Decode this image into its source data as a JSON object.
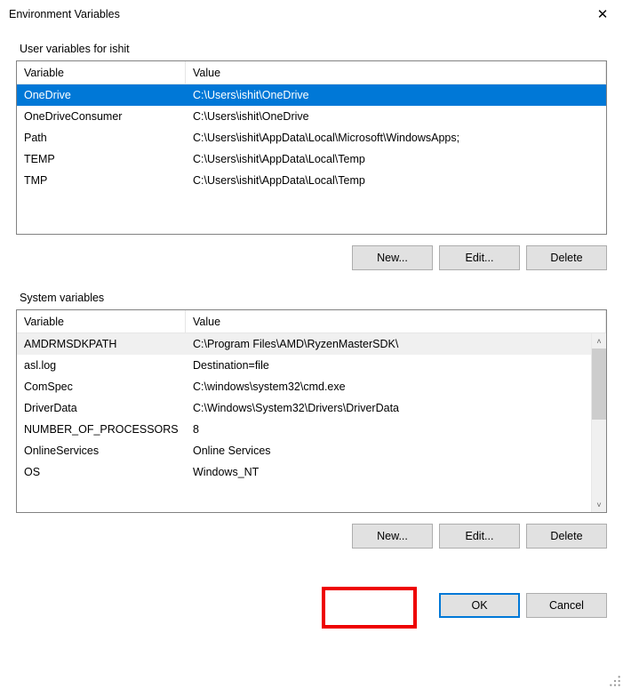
{
  "window": {
    "title": "Environment Variables",
    "close_glyph": "✕"
  },
  "user_section": {
    "label": "User variables for ishit",
    "headers": {
      "variable": "Variable",
      "value": "Value"
    },
    "rows": [
      {
        "variable": "OneDrive",
        "value": "C:\\Users\\ishit\\OneDrive"
      },
      {
        "variable": "OneDriveConsumer",
        "value": "C:\\Users\\ishit\\OneDrive"
      },
      {
        "variable": "Path",
        "value": "C:\\Users\\ishit\\AppData\\Local\\Microsoft\\WindowsApps;"
      },
      {
        "variable": "TEMP",
        "value": "C:\\Users\\ishit\\AppData\\Local\\Temp"
      },
      {
        "variable": "TMP",
        "value": "C:\\Users\\ishit\\AppData\\Local\\Temp"
      }
    ],
    "buttons": {
      "new": "New...",
      "edit": "Edit...",
      "delete": "Delete"
    }
  },
  "system_section": {
    "label": "System variables",
    "headers": {
      "variable": "Variable",
      "value": "Value"
    },
    "rows": [
      {
        "variable": "AMDRMSDKPATH",
        "value": "C:\\Program Files\\AMD\\RyzenMasterSDK\\"
      },
      {
        "variable": "asl.log",
        "value": "Destination=file"
      },
      {
        "variable": "ComSpec",
        "value": "C:\\windows\\system32\\cmd.exe"
      },
      {
        "variable": "DriverData",
        "value": "C:\\Windows\\System32\\Drivers\\DriverData"
      },
      {
        "variable": "NUMBER_OF_PROCESSORS",
        "value": "8"
      },
      {
        "variable": "OnlineServices",
        "value": "Online Services"
      },
      {
        "variable": "OS",
        "value": "Windows_NT"
      }
    ],
    "buttons": {
      "new": "New...",
      "edit": "Edit...",
      "delete": "Delete"
    },
    "scroll": {
      "up": "˄",
      "down": "˅"
    }
  },
  "dialog_buttons": {
    "ok": "OK",
    "cancel": "Cancel"
  }
}
